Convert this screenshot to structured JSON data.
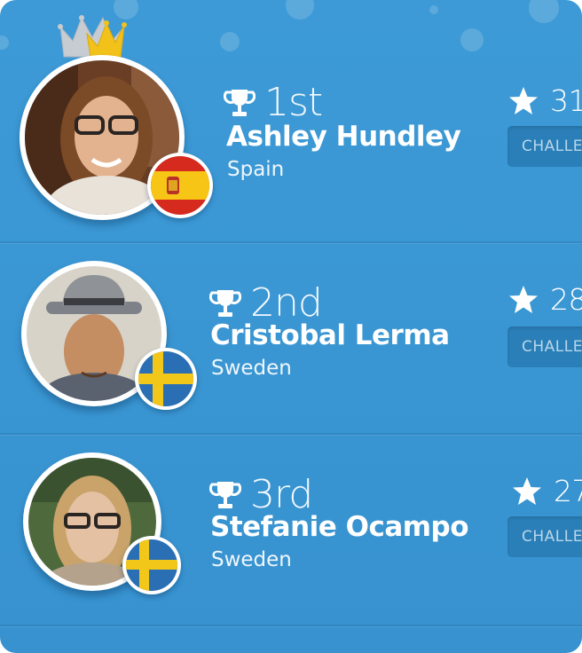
{
  "leaderboard": {
    "players": [
      {
        "rank": "1st",
        "name": "Ashley Hundley",
        "country": "Spain",
        "score": "31",
        "action_label": "CHALLE",
        "flag": "spain-flag-icon",
        "has_crown": true
      },
      {
        "rank": "2nd",
        "name": "Cristobal Lerma",
        "country": "Sweden",
        "score": "28",
        "action_label": "CHALLE",
        "flag": "sweden-flag-icon",
        "has_crown": false
      },
      {
        "rank": "3rd",
        "name": "Stefanie Ocampo",
        "country": "Sweden",
        "score": "27",
        "action_label": "CHALLE",
        "flag": "sweden-flag-icon",
        "has_crown": false
      }
    ]
  },
  "colors": {
    "background": "#3a97d3",
    "button": "#2a7fb8",
    "crown_gold": "#f2c21a",
    "crown_silver": "#c7ccd2",
    "spain_red": "#d62a1e",
    "spain_yellow": "#f6c515",
    "sweden_blue": "#2a6fb4",
    "sweden_yellow": "#f3c61a"
  },
  "icons": {
    "trophy": "trophy-icon",
    "star": "star-icon",
    "crown": "crown-icon"
  }
}
